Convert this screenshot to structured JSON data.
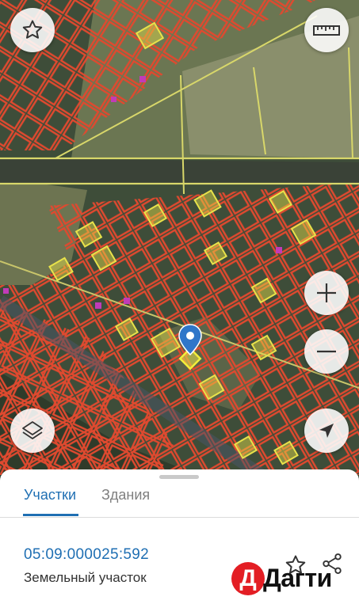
{
  "map": {
    "controls": {
      "favorites_icon": "star-outline-icon",
      "ruler_icon": "ruler-icon",
      "zoom_in_icon": "plus-icon",
      "zoom_out_icon": "minus-icon",
      "layers_icon": "layers-icon",
      "locate_icon": "navigation-arrow-icon"
    },
    "marker_icon": "map-pin-icon",
    "colors": {
      "parcel_outline": "#e0492f",
      "highlight": "#e8e24a",
      "marker": "#2f76c9",
      "accent": "#1f6fb3"
    }
  },
  "sheet": {
    "tabs": [
      {
        "label": "Участки",
        "active": true
      },
      {
        "label": "Здания",
        "active": false
      }
    ],
    "cadastral_number": "05:09:000025:592",
    "object_type": "Земельный участок",
    "favorite_icon": "star-outline-icon",
    "share_icon": "share-icon",
    "brand": {
      "logo_letter": "Д",
      "logo_text": "Дагти",
      "logo_color": "#e31e24"
    }
  }
}
